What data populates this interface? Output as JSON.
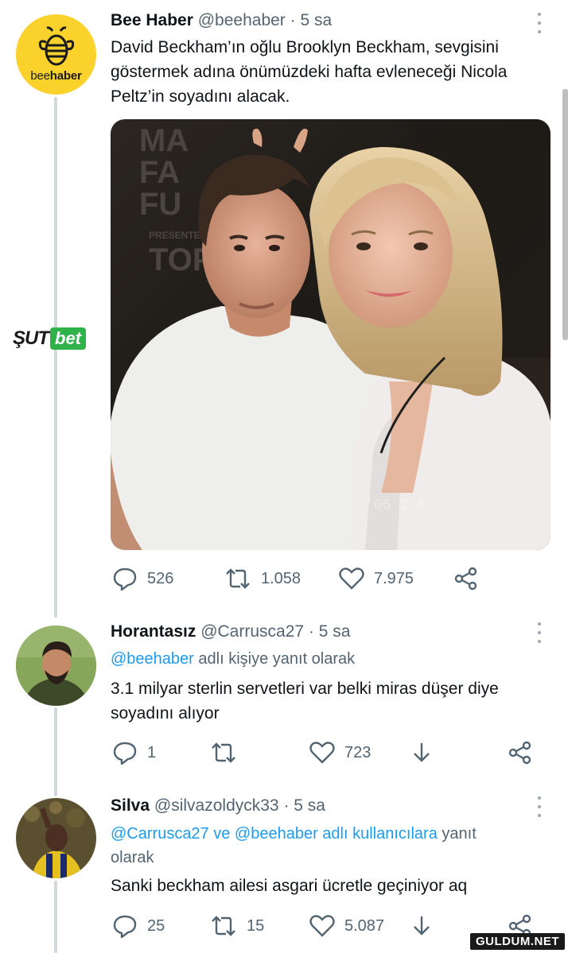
{
  "tweets": [
    {
      "name": "Bee Haber",
      "handle": "@beehaber",
      "time": "5 sa",
      "avatar_text_light": "bee",
      "avatar_text_bold": "haber",
      "text_lines": [
        "David Beckham’ın oğlu Brooklyn Beckham, sevgisini",
        "göstermek adına önümüzdeki hafta evleneceği Nicola",
        "Peltz’in soyadını alacak."
      ],
      "replies": "526",
      "retweets": "1.058",
      "likes": "7.975"
    },
    {
      "name": "Horantasız",
      "handle": "@Carrusca27",
      "time": "5 sa",
      "reply_to_link": "@beehaber",
      "reply_to_suffix": "adlı kişiye yanıt olarak",
      "text_lines": [
        "3.1 milyar sterlin servetleri var belki miras düşer diye",
        "soyadını alıyor"
      ],
      "replies": "1",
      "retweets": "",
      "likes": "723"
    },
    {
      "name": "Silva",
      "handle": "@silvazoldyck33",
      "time": "5 sa",
      "reply_to_link": "@Carrusca27 ve @beehaber adlı kullanıcılara",
      "reply_to_suffix": "yanıt",
      "reply_to_line2": "olarak",
      "text_lines": [
        "Sanki beckham ailesi asgari ücretle geçiniyor aq"
      ],
      "replies": "25",
      "retweets": "15",
      "likes": "5.087"
    }
  ],
  "sponsor": {
    "sut": "ŞUT",
    "bet": "bet"
  },
  "watermark": "GULDUM.NET",
  "photo_sign_text": [
    "MA",
    "FA",
    "FU",
    "PRESENTED",
    "TOP"
  ],
  "colors": {
    "link": "#1d9bf0",
    "muted": "#536471",
    "thread_line": "#cfd9de",
    "bee_yellow": "#fbd12c"
  }
}
